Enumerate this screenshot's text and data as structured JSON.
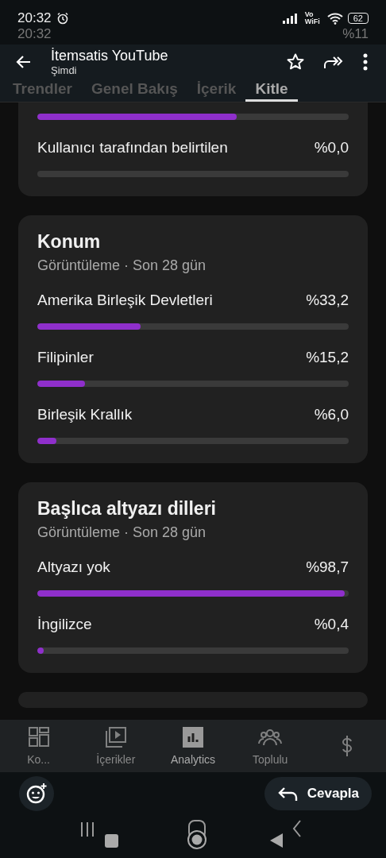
{
  "status_bar": {
    "time": "20:32",
    "network": "Vo WiFi",
    "battery": "62",
    "ghost_time": "20:32",
    "ghost_battery": "%11"
  },
  "notification": {
    "title": "İtemsatis YouTube",
    "time": "Şimdi",
    "reply": "Cevapla"
  },
  "tabs": [
    {
      "label": "Trendler",
      "selected": false
    },
    {
      "label": "Genel Bakış",
      "selected": false
    },
    {
      "label": "İçerik",
      "selected": false
    },
    {
      "label": "Kitle",
      "selected": true
    }
  ],
  "cards": [
    {
      "rows": [
        {
          "label": null,
          "value": null,
          "level": 0.64
        },
        {
          "label": "Kullanıcı tarafından belirtilen",
          "value": "%0,0"
        }
      ]
    },
    {
      "title": "Konum",
      "subtitle": "Görüntüleme · Son 28 gün",
      "rows": [
        {
          "label": "Amerika Birleşik Devletleri",
          "value": "%33,2",
          "level": 0.332
        },
        {
          "label": "Filipinler",
          "value": "%15,2",
          "level": 0.152
        },
        {
          "label": "Birleşik Krallık",
          "value": "%6,0",
          "level": 0.06
        }
      ]
    },
    {
      "title": "Başlıca altyazı dilleri",
      "subtitle": "Görüntüleme · Son 28 gün",
      "rows": [
        {
          "label": "Altyazı yok",
          "value": "%98,7",
          "level": 0.987
        },
        {
          "label": "İngilizce",
          "value": "%0,4",
          "level": 0.02
        }
      ]
    }
  ],
  "bottom_nav": [
    {
      "label": "Ko...",
      "kind": "dashboard",
      "selected": false
    },
    {
      "label": "İçerikler",
      "kind": "content",
      "selected": false
    },
    {
      "label": "Analytics",
      "kind": "analytics",
      "selected": true
    },
    {
      "label": "Toplulu",
      "kind": "community",
      "selected": false
    },
    {
      "kind": "earn",
      "selected": false
    }
  ]
}
